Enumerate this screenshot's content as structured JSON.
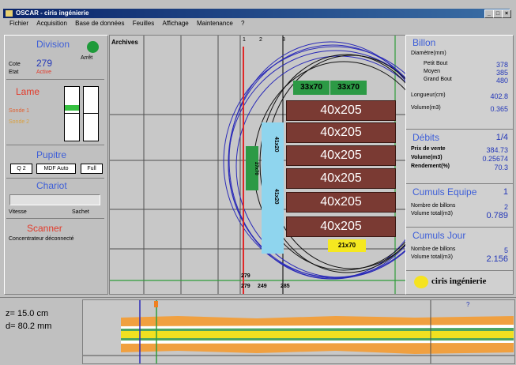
{
  "window": {
    "title": "OSCAR - ciris ingénierie",
    "min": "_",
    "max": "□",
    "close": "×"
  },
  "menu": [
    "Fichier",
    "Acquisition",
    "Base de données",
    "Feuilles",
    "Affichage",
    "Maintenance",
    "?"
  ],
  "left": {
    "division_title": "Division",
    "arret": "Arrêt",
    "cote_label": "Cote",
    "cote_value": "279",
    "etat_label": "Etat",
    "etat_value": "Active",
    "lame_title": "Lame",
    "sonde_1": "Sonde 1",
    "sonde_2": "Sonde 2",
    "pupitre_title": "Pupitre",
    "pupitre_buttons": [
      "Q 2",
      "MDF Auto",
      "Full"
    ],
    "chariot_title": "Chariot",
    "vitesse": "Vitesse",
    "sachet": "Sachet",
    "scanner_title": "Scanner",
    "scanner_status": "Concentrateur déconnecté"
  },
  "center": {
    "archives": "Archives",
    "col_labels": [
      "1",
      "2",
      "3"
    ],
    "bottom_labels": [
      "279",
      "279",
      "249",
      "285"
    ],
    "top_small": [
      "33x70",
      "33x70"
    ],
    "planks": [
      "40x205",
      "40x205",
      "40x205",
      "40x205",
      "40x205",
      "40x205"
    ],
    "side_left": "27x70",
    "side_mid_top": "41x20",
    "side_mid_bot": "41x20",
    "bottom_small": "21x70"
  },
  "right": {
    "billon": {
      "title": "Billon",
      "sub": "Diamètre(mm)",
      "rows": [
        [
          "Petit Bout",
          "378"
        ],
        [
          "Moyen",
          "385"
        ],
        [
          "Grand Bout",
          "480"
        ],
        [
          "Longueur(cm)",
          "402.8"
        ],
        [
          "Volume(m3)",
          "0.365"
        ]
      ]
    },
    "debits": {
      "title": "Débits",
      "value": "1/4",
      "rows": [
        [
          "Prix de vente",
          "384.73"
        ],
        [
          "Volume(m3)",
          "0.25674"
        ],
        [
          "Rendement(%)",
          "70.3"
        ]
      ]
    },
    "cumuls_equipe": {
      "title": "Cumuls Equipe",
      "value": "1",
      "rows": [
        [
          "Nombre de billons",
          "2"
        ],
        [
          "Volume total(m3)",
          "0.789"
        ]
      ]
    },
    "cumuls_jour": {
      "title": "Cumuls Jour",
      "value": "",
      "rows": [
        [
          "Nombre de billons",
          "5"
        ],
        [
          "Volume total(m3)",
          "2.156"
        ]
      ]
    },
    "logo": "ciris ingénierie"
  },
  "bottom": {
    "z": "z= 15.0 cm",
    "d": "d= 80.2 mm",
    "marker": "?"
  }
}
